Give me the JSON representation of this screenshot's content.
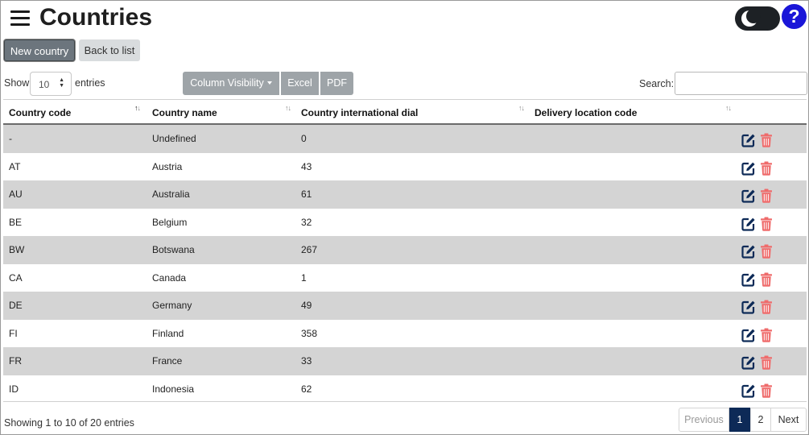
{
  "header": {
    "title": "Countries",
    "help_label": "?"
  },
  "actions": {
    "new_label": "New country",
    "back_label": "Back to list"
  },
  "length": {
    "show_label": "Show",
    "value": "10",
    "entries_label": "entries"
  },
  "toolbar": {
    "colvis_label": "Column Visibility",
    "excel_label": "Excel",
    "pdf_label": "PDF"
  },
  "search": {
    "label": "Search:",
    "value": ""
  },
  "table": {
    "columns": [
      "Country code",
      "Country name",
      "Country international dial",
      "Delivery location code"
    ],
    "rows": [
      {
        "code": "-",
        "name": "Undefined",
        "dial": "0",
        "delivery": ""
      },
      {
        "code": "AT",
        "name": "Austria",
        "dial": "43",
        "delivery": ""
      },
      {
        "code": "AU",
        "name": "Australia",
        "dial": "61",
        "delivery": ""
      },
      {
        "code": "BE",
        "name": "Belgium",
        "dial": "32",
        "delivery": ""
      },
      {
        "code": "BW",
        "name": "Botswana",
        "dial": "267",
        "delivery": ""
      },
      {
        "code": "CA",
        "name": "Canada",
        "dial": "1",
        "delivery": ""
      },
      {
        "code": "DE",
        "name": "Germany",
        "dial": "49",
        "delivery": ""
      },
      {
        "code": "FI",
        "name": "Finland",
        "dial": "358",
        "delivery": ""
      },
      {
        "code": "FR",
        "name": "France",
        "dial": "33",
        "delivery": ""
      },
      {
        "code": "ID",
        "name": "Indonesia",
        "dial": "62",
        "delivery": ""
      }
    ]
  },
  "footer": {
    "info": "Showing 1 to 10 of 20 entries"
  },
  "pagination": {
    "previous": "Previous",
    "pages": [
      "1",
      "2"
    ],
    "next": "Next"
  },
  "colors": {
    "edit_icon": "#0d2a57",
    "delete_icon": "#ef6b6b",
    "active_page": "#0d2a57",
    "help": "#1a16d8",
    "stripe": "#d4d4d4"
  }
}
